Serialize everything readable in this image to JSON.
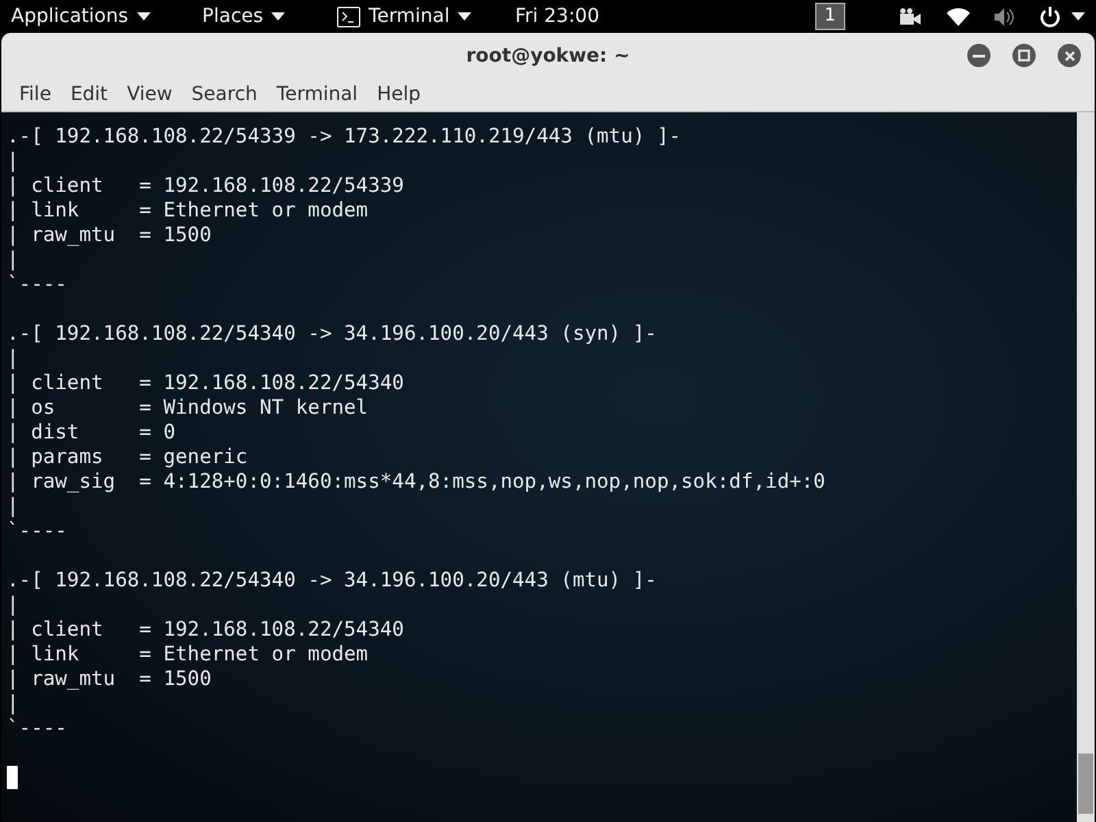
{
  "top_bar": {
    "menus": [
      {
        "label": "Applications",
        "kind": "menu"
      },
      {
        "label": "Places",
        "kind": "menu"
      },
      {
        "label": "Terminal",
        "kind": "app"
      }
    ],
    "clock": "Fri 23:00",
    "workspace": "1"
  },
  "window": {
    "title": "root@yokwe: ~"
  },
  "menu_bar": [
    "File",
    "Edit",
    "View",
    "Search",
    "Terminal",
    "Help"
  ],
  "terminal": {
    "blocks": [
      {
        "lines": [
          ".-[ 192.168.108.22/54339 -> 173.222.110.219/443 (mtu) ]-",
          "|",
          "| client   = 192.168.108.22/54339",
          "| link     = Ethernet or modem",
          "| raw_mtu  = 1500",
          "|",
          "`----"
        ]
      },
      {
        "lines": [
          ".-[ 192.168.108.22/54340 -> 34.196.100.20/443 (syn) ]-",
          "|",
          "| client   = 192.168.108.22/54340",
          "| os       = Windows NT kernel",
          "| dist     = 0",
          "| params   = generic",
          "| raw_sig  = 4:128+0:0:1460:mss*44,8:mss,nop,ws,nop,nop,sok:df,id+:0",
          "|",
          "`----"
        ]
      },
      {
        "lines": [
          ".-[ 192.168.108.22/54340 -> 34.196.100.20/443 (mtu) ]-",
          "|",
          "| client   = 192.168.108.22/54340",
          "| link     = Ethernet or modem",
          "| raw_mtu  = 1500",
          "|",
          "`----"
        ]
      }
    ]
  }
}
